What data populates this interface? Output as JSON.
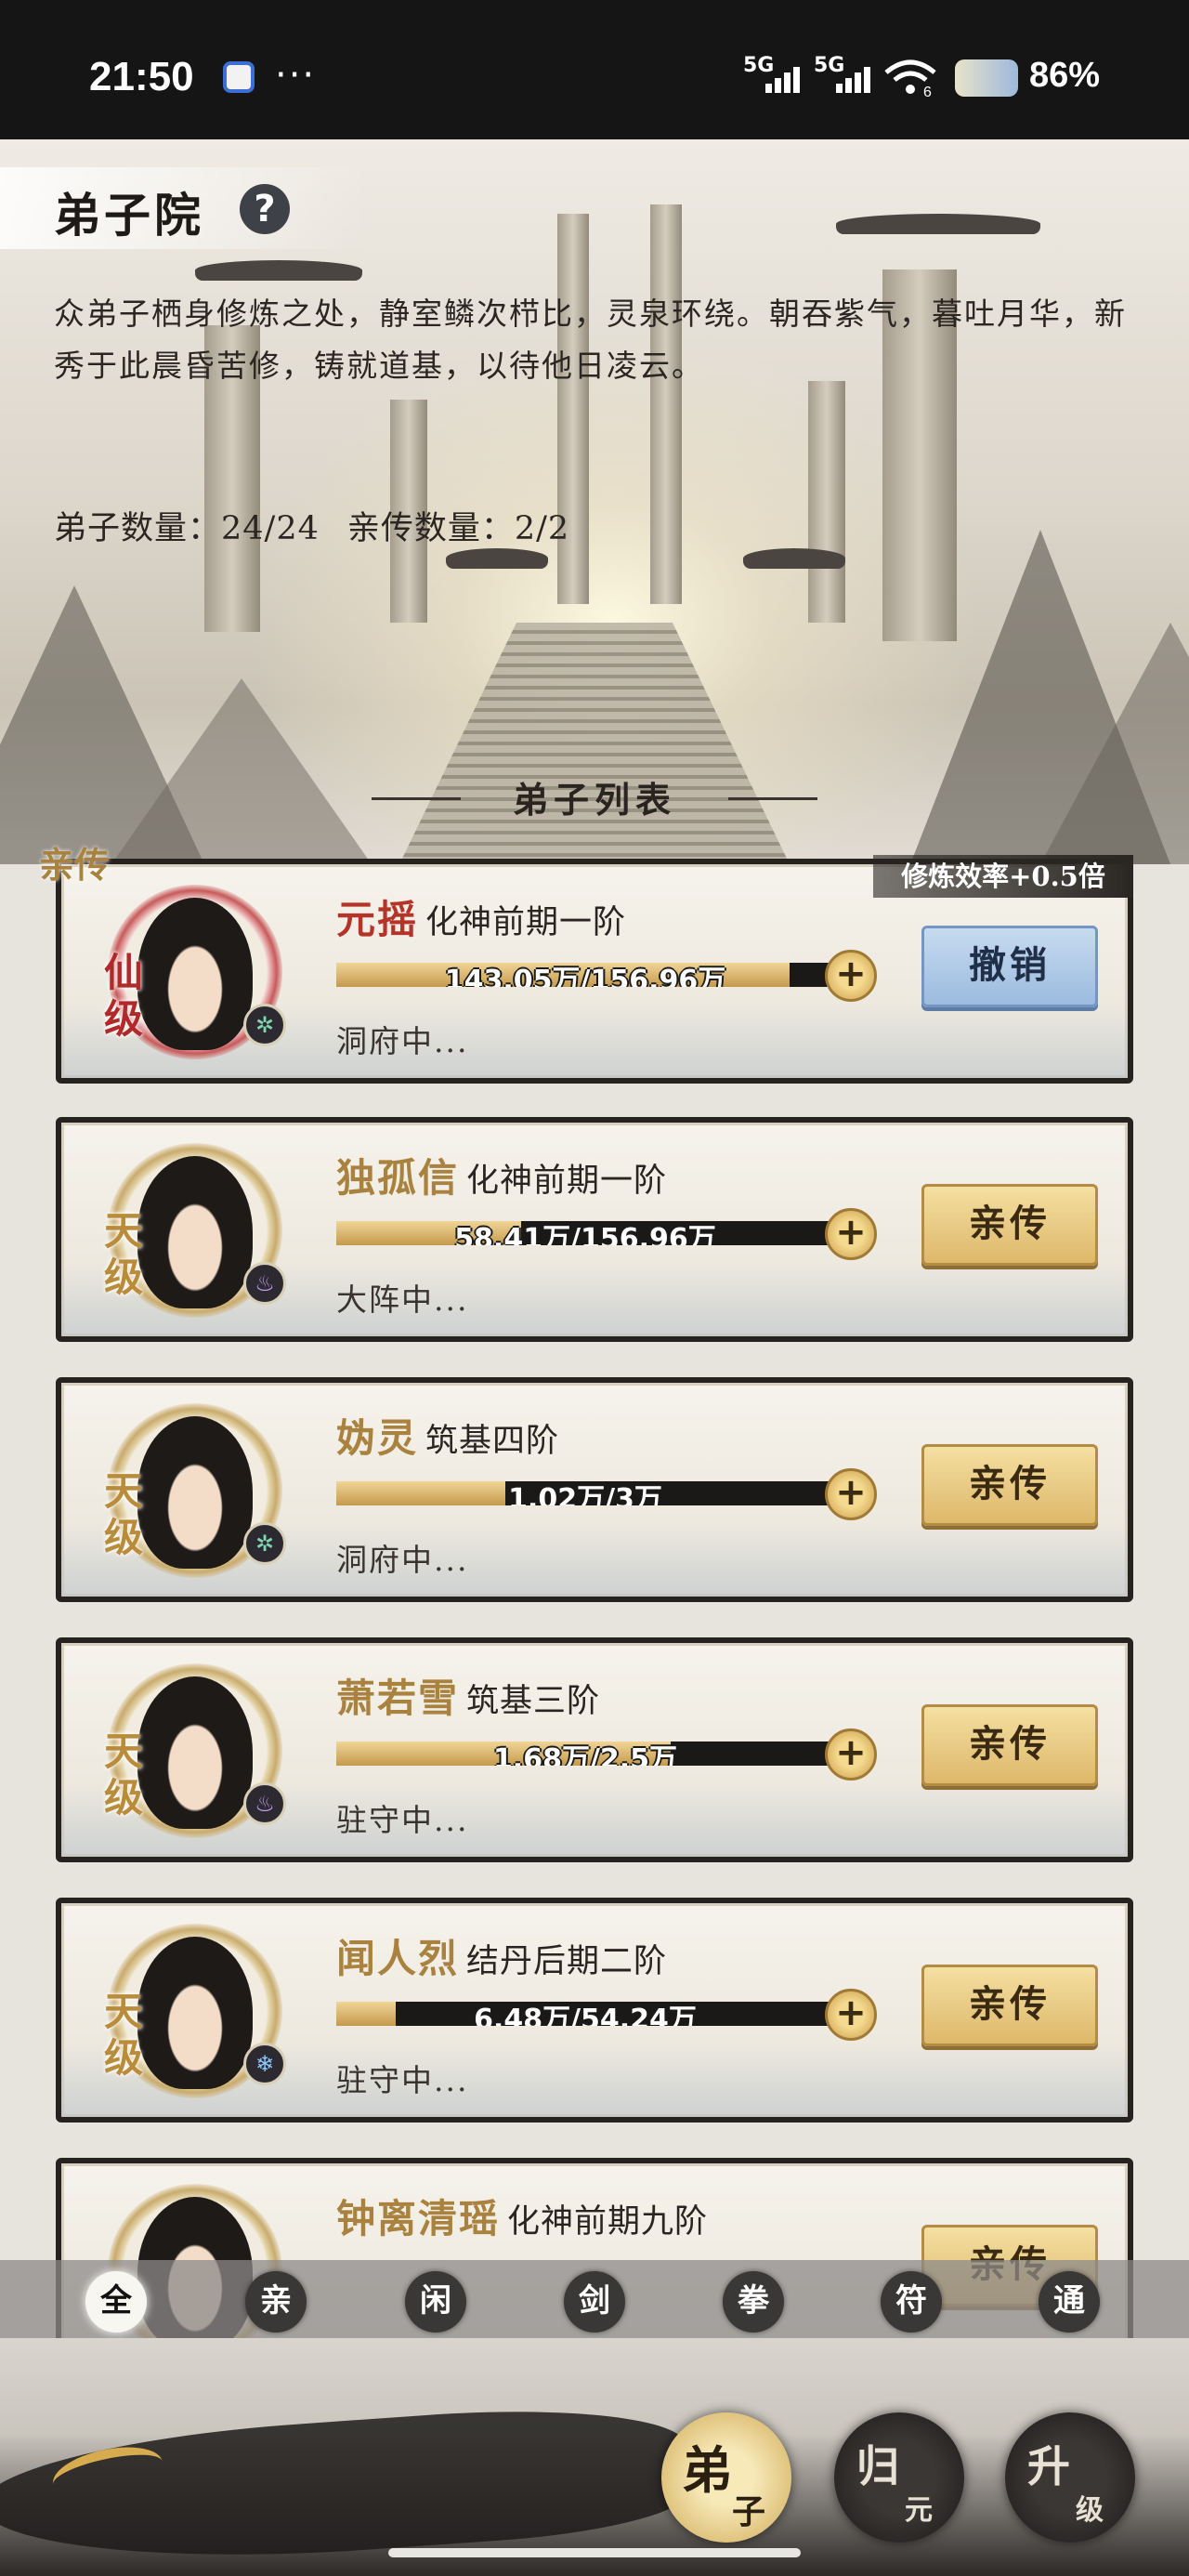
{
  "status_bar": {
    "time": "21:50",
    "dots": "···",
    "signal_1": "5G",
    "signal_2": "5G",
    "wifi_badge": "6",
    "battery": "86%"
  },
  "header": {
    "title": "弟子院",
    "help_icon": "?",
    "description": "众弟子栖身修炼之处，静室鳞次栉比，灵泉环绕。朝吞紫气，暮吐月华，新秀于此晨昏苦修，铸就道基，以待他日凌云。",
    "disciple_count": "弟子数量：24/24",
    "direct_count": "亲传数量：2/2",
    "list_title": "弟子列表"
  },
  "pinned_tag": "亲传",
  "boost_tag": "修炼效率+0.5倍",
  "disciples": [
    {
      "grade": "仙级",
      "name": "元摇",
      "realm": "化神前期一阶",
      "progress_text": "143.05万/156.96万",
      "progress": 0.911,
      "status": "洞府中...",
      "action": "撤销",
      "element": "wind"
    },
    {
      "grade": "天级",
      "name": "独孤信",
      "realm": "化神前期一阶",
      "progress_text": "58.41万/156.96万",
      "progress": 0.372,
      "status": "大阵中...",
      "action": "亲传",
      "element": "fire"
    },
    {
      "grade": "天级",
      "name": "妫灵",
      "realm": "筑基四阶",
      "progress_text": "1.02万/3万",
      "progress": 0.34,
      "status": "洞府中...",
      "action": "亲传",
      "element": "wind"
    },
    {
      "grade": "天级",
      "name": "萧若雪",
      "realm": "筑基三阶",
      "progress_text": "1.68万/2.5万",
      "progress": 0.672,
      "status": "驻守中...",
      "action": "亲传",
      "element": "fire"
    },
    {
      "grade": "天级",
      "name": "闻人烈",
      "realm": "结丹后期二阶",
      "progress_text": "6.48万/54.24万",
      "progress": 0.119,
      "status": "驻守中...",
      "action": "亲传",
      "element": "ice"
    },
    {
      "grade": "天级",
      "name": "钟离清瑶",
      "realm": "化神前期九阶",
      "progress_text": "",
      "progress": 0.0,
      "status": "",
      "action": "亲传",
      "element": ""
    }
  ],
  "filter_tabs": [
    "全",
    "亲",
    "闲",
    "剑",
    "拳",
    "符",
    "通"
  ],
  "bottom_nav": [
    {
      "l1": "弟",
      "l2": "子"
    },
    {
      "l1": "归",
      "l2": "元"
    },
    {
      "l1": "升",
      "l2": "级"
    }
  ],
  "colors": {
    "accent_gold": "#a8823e",
    "accent_red": "#b5342a",
    "button_gold": "#ddb86a",
    "button_blue": "#9bbbe0"
  }
}
